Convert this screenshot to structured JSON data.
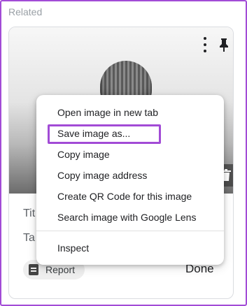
{
  "panel": {
    "heading": "Related"
  },
  "card": {
    "title_partial": "Tit",
    "tags_partial": "Ta",
    "report_label": "Report",
    "done_label": "Done"
  },
  "icons": {
    "more": "more-vert-icon",
    "pin": "pin-icon",
    "delete": "trash-icon",
    "report": "report-icon"
  },
  "context_menu": {
    "items": [
      {
        "label": "Open image in new tab"
      },
      {
        "label": "Save image as..."
      },
      {
        "label": "Copy image"
      },
      {
        "label": "Copy image address"
      },
      {
        "label": "Create QR Code for this image"
      },
      {
        "label": "Search image with Google Lens"
      },
      {
        "label": "Inspect"
      }
    ],
    "highlighted_item": "Save image as..."
  },
  "colors": {
    "highlight": "#a24bd6",
    "text": "#202124",
    "muted": "#9aa0a6"
  }
}
